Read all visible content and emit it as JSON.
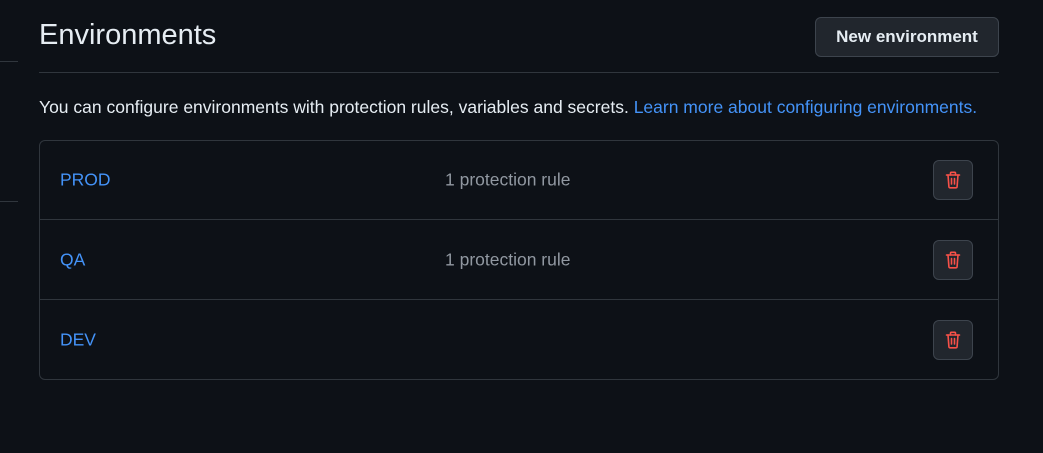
{
  "header": {
    "title": "Environments",
    "new_button_label": "New environment"
  },
  "description": {
    "text": "You can configure environments with protection rules, variables and secrets. ",
    "link_text": "Learn more about configuring environments."
  },
  "environments": [
    {
      "name": "PROD",
      "rules": "1 protection rule"
    },
    {
      "name": "QA",
      "rules": "1 protection rule"
    },
    {
      "name": "DEV",
      "rules": ""
    }
  ],
  "colors": {
    "background": "#0d1117",
    "link": "#4493f8",
    "danger": "#f85149",
    "muted": "#9198a1",
    "border": "#30363d"
  },
  "icons": {
    "delete": "trash-icon"
  }
}
